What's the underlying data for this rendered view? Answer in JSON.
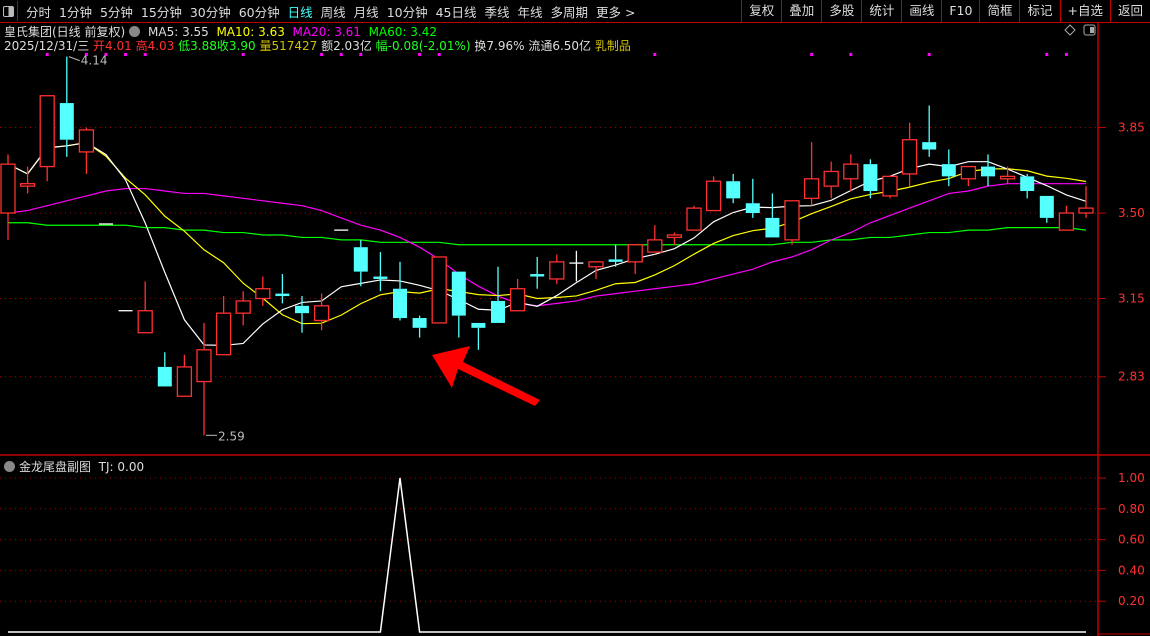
{
  "toolbar": {
    "periods": [
      "分时",
      "1分钟",
      "5分钟",
      "15分钟",
      "30分钟",
      "60分钟",
      "日线",
      "周线",
      "月线",
      "10分钟",
      "45日线",
      "季线",
      "年线",
      "多周期",
      "更多 >"
    ],
    "active_period": "日线",
    "buttons": [
      "复权",
      "叠加",
      "多股",
      "统计",
      "画线",
      "F10",
      "简框",
      "标记",
      "+自选",
      "返回"
    ]
  },
  "header": {
    "title": "皇氏集团(日线 前复权)",
    "ma5": "MA5: 3.55",
    "ma10": "MA10: 3.63",
    "ma20": "MA20: 3.61",
    "ma60": "MA60: 3.42",
    "date": "2025/12/31/三",
    "open": "开4.01",
    "high": "高4.03",
    "low": "低3.88",
    "close": "收3.90",
    "volume": "量517427",
    "amount": "额2.03亿",
    "change": "幅-0.08(-2.01%)",
    "turnover": "换7.96%",
    "float": "流通6.50亿",
    "sector": "乳制品"
  },
  "subchart": {
    "title": "金龙尾盘副图",
    "value": "TJ: 0.00"
  },
  "colors": {
    "up": "#ff3030",
    "down": "#54ffff",
    "ma5": "#ffffff",
    "ma10": "#ffff00",
    "ma20": "#ff00ff",
    "ma60": "#00ff00",
    "grid": "#a00000",
    "axis": "#c00000"
  },
  "chart_data": [
    {
      "type": "candlestick",
      "y_ticks": [
        "3.85",
        "3.50",
        "3.15",
        "2.83"
      ],
      "max_label": "4.14",
      "min_label": "2.59",
      "candles": [
        [
          3.5,
          3.7,
          3.74,
          3.39
        ],
        [
          3.61,
          3.62,
          3.69,
          3.58
        ],
        [
          3.69,
          3.98,
          3.98,
          3.63
        ],
        [
          3.95,
          3.8,
          4.14,
          3.73
        ],
        [
          3.75,
          3.84,
          3.85,
          3.66
        ],
        [
          3.455,
          3.455,
          3.455,
          3.455
        ],
        [
          3.1,
          3.1,
          3.1,
          3.1
        ],
        [
          3.01,
          3.1,
          3.22,
          3.01
        ],
        [
          2.87,
          2.79,
          2.93,
          2.79
        ],
        [
          2.75,
          2.87,
          2.92,
          2.75
        ],
        [
          2.81,
          2.94,
          3.05,
          2.59
        ],
        [
          2.92,
          3.09,
          3.16,
          2.92
        ],
        [
          3.09,
          3.14,
          3.18,
          3.04
        ],
        [
          3.15,
          3.19,
          3.24,
          3.12
        ],
        [
          3.17,
          3.16,
          3.25,
          3.13
        ],
        [
          3.12,
          3.09,
          3.16,
          3.01
        ],
        [
          3.06,
          3.12,
          3.17,
          3.02
        ],
        [
          3.43,
          3.43,
          3.43,
          3.43
        ],
        [
          3.36,
          3.26,
          3.39,
          3.2
        ],
        [
          3.24,
          3.23,
          3.34,
          3.18
        ],
        [
          3.19,
          3.07,
          3.3,
          3.06
        ],
        [
          3.07,
          3.03,
          3.08,
          2.99
        ],
        [
          3.05,
          3.32,
          3.32,
          3.05
        ],
        [
          3.26,
          3.08,
          3.26,
          2.99
        ],
        [
          3.05,
          3.03,
          3.05,
          2.94
        ],
        [
          3.14,
          3.05,
          3.28,
          3.05
        ],
        [
          3.1,
          3.19,
          3.23,
          3.1
        ],
        [
          3.25,
          3.24,
          3.32,
          3.19
        ],
        [
          3.23,
          3.3,
          3.33,
          3.21
        ],
        [
          3.295,
          3.295,
          3.345,
          3.22
        ],
        [
          3.28,
          3.3,
          3.3,
          3.23
        ],
        [
          3.31,
          3.3,
          3.37,
          3.28
        ],
        [
          3.3,
          3.37,
          3.37,
          3.25
        ],
        [
          3.34,
          3.39,
          3.45,
          3.34
        ],
        [
          3.4,
          3.41,
          3.42,
          3.37
        ],
        [
          3.43,
          3.52,
          3.53,
          3.43
        ],
        [
          3.51,
          3.63,
          3.65,
          3.51
        ],
        [
          3.63,
          3.56,
          3.66,
          3.54
        ],
        [
          3.54,
          3.5,
          3.64,
          3.48
        ],
        [
          3.48,
          3.4,
          3.58,
          3.4
        ],
        [
          3.39,
          3.55,
          3.55,
          3.37
        ],
        [
          3.56,
          3.64,
          3.79,
          3.53
        ],
        [
          3.61,
          3.67,
          3.71,
          3.56
        ],
        [
          3.64,
          3.7,
          3.74,
          3.59
        ],
        [
          3.7,
          3.59,
          3.72,
          3.56
        ],
        [
          3.57,
          3.65,
          3.65,
          3.56
        ],
        [
          3.66,
          3.8,
          3.87,
          3.61
        ],
        [
          3.79,
          3.76,
          3.94,
          3.73
        ],
        [
          3.7,
          3.65,
          3.76,
          3.61
        ],
        [
          3.64,
          3.69,
          3.69,
          3.61
        ],
        [
          3.69,
          3.65,
          3.74,
          3.61
        ],
        [
          3.64,
          3.65,
          3.69,
          3.62
        ],
        [
          3.65,
          3.59,
          3.66,
          3.56
        ],
        [
          3.57,
          3.48,
          3.57,
          3.46
        ],
        [
          3.43,
          3.5,
          3.53,
          3.43
        ],
        [
          3.5,
          3.52,
          3.61,
          3.48
        ]
      ],
      "candle_fields": [
        "open",
        "close",
        "high",
        "low"
      ],
      "ma20": [
        3.5,
        3.51,
        3.53,
        3.55,
        3.57,
        3.59,
        3.6,
        3.6,
        3.59,
        3.58,
        3.58,
        3.57,
        3.56,
        3.55,
        3.54,
        3.53,
        3.51,
        3.48,
        3.45,
        3.43,
        3.4,
        3.36,
        3.31,
        3.25,
        3.2,
        3.16,
        3.13,
        3.12,
        3.13,
        3.14,
        3.16,
        3.17,
        3.18,
        3.19,
        3.2,
        3.21,
        3.23,
        3.25,
        3.27,
        3.3,
        3.32,
        3.35,
        3.39,
        3.42,
        3.46,
        3.49,
        3.52,
        3.55,
        3.58,
        3.59,
        3.61,
        3.62,
        3.62,
        3.62,
        3.62,
        3.62
      ],
      "ma60": [
        3.46,
        3.46,
        3.45,
        3.45,
        3.45,
        3.45,
        3.45,
        3.44,
        3.44,
        3.43,
        3.43,
        3.42,
        3.42,
        3.41,
        3.41,
        3.4,
        3.4,
        3.39,
        3.39,
        3.38,
        3.38,
        3.38,
        3.38,
        3.37,
        3.37,
        3.37,
        3.37,
        3.37,
        3.37,
        3.37,
        3.37,
        3.37,
        3.37,
        3.37,
        3.37,
        3.37,
        3.37,
        3.37,
        3.37,
        3.37,
        3.38,
        3.38,
        3.39,
        3.39,
        3.4,
        3.4,
        3.41,
        3.42,
        3.42,
        3.43,
        3.43,
        3.44,
        3.44,
        3.44,
        3.44,
        3.43
      ],
      "signal_markers": [
        2,
        4,
        5,
        6,
        7,
        12,
        16,
        17,
        18,
        21,
        22,
        33,
        41,
        43,
        47,
        53,
        54
      ]
    },
    {
      "type": "line",
      "name": "TJ",
      "y_ticks": [
        "1.00",
        "0.80",
        "0.60",
        "0.40",
        "0.20"
      ],
      "ylim": [
        0,
        1.05
      ],
      "spike_index": 20,
      "values_note_free": true
    }
  ]
}
